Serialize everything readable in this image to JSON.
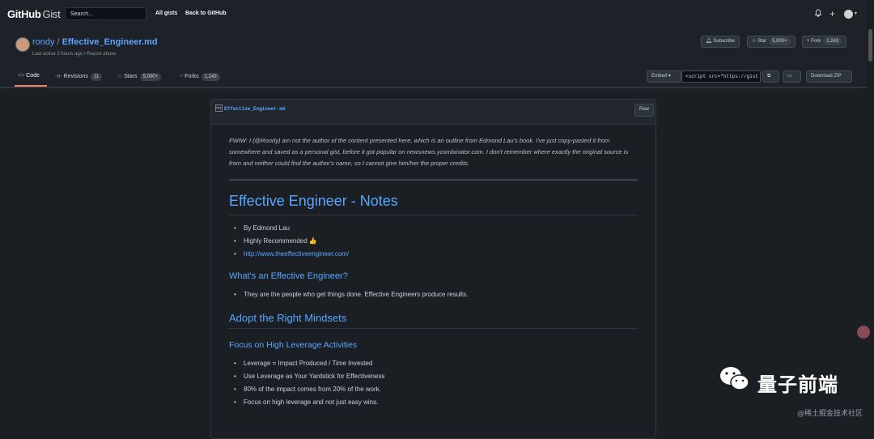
{
  "header": {
    "logo_main": "GitHub",
    "logo_sub": "Gist",
    "search_placeholder": "Search...",
    "links": [
      "All gists",
      "Back to GitHub"
    ],
    "icons": [
      "bell-icon",
      "plus-icon",
      "user-avatar"
    ]
  },
  "gist": {
    "owner": "rondy",
    "separator": "/",
    "filename": "Effective_Engineer.md",
    "meta": "Last active 2 hours ago • Report abuse",
    "actions": {
      "subscribe": "Subscribe",
      "star": "Star",
      "star_count": "5,000+",
      "fork": "Fork",
      "fork_count": "1,243"
    },
    "tabs": [
      {
        "label": "Code",
        "count": ""
      },
      {
        "label": "Revisions",
        "count": "11"
      },
      {
        "label": "Stars",
        "count": "5,000+"
      },
      {
        "label": "Forks",
        "count": "1,243"
      }
    ],
    "embed_label": "Embed",
    "embed_value": "<script src=\"https://gist",
    "download": "Download ZIP"
  },
  "file": {
    "name": "Effective_Engineer.md",
    "raw": "Raw"
  },
  "content": {
    "intro": "FWIW: I (@Rondy) am not the author of the content presented here, which is an outline from Edmond Lau's book. I've just copy-pasted it from somewhere and saved as a personal gist, before it got popular on newsnews.ycombinator.com. I don't remember where exactly the original source is from and neither could find the author's name, so I cannot give him/her the proper credits.",
    "h1": "Effective Engineer - Notes",
    "list1": [
      "By Edmond Lau",
      "Highly Recommended 👍",
      "http://www.theeffectiveengineer.com/"
    ],
    "h2a": "What's an Effective Engineer?",
    "list2": [
      "They are the people who get things done. Effective Engineers produce results."
    ],
    "h2b": "Adopt the Right Mindsets",
    "h3a": "Focus on High Leverage Activities",
    "list3": [
      "Leverage = Impact Produced / Time Invested",
      "Use Leverage as Your Yardstick for Effectiveness",
      "80% of the impact comes from 20% of the work.",
      "Focus on high leverage and not just easy wins."
    ]
  },
  "watermark": {
    "title": "量子前端",
    "sub": "@稀土掘金技术社区"
  },
  "colors": {
    "accent": "#58a6ff",
    "background": "#1b1f24",
    "tab_underline": "#f78166"
  }
}
